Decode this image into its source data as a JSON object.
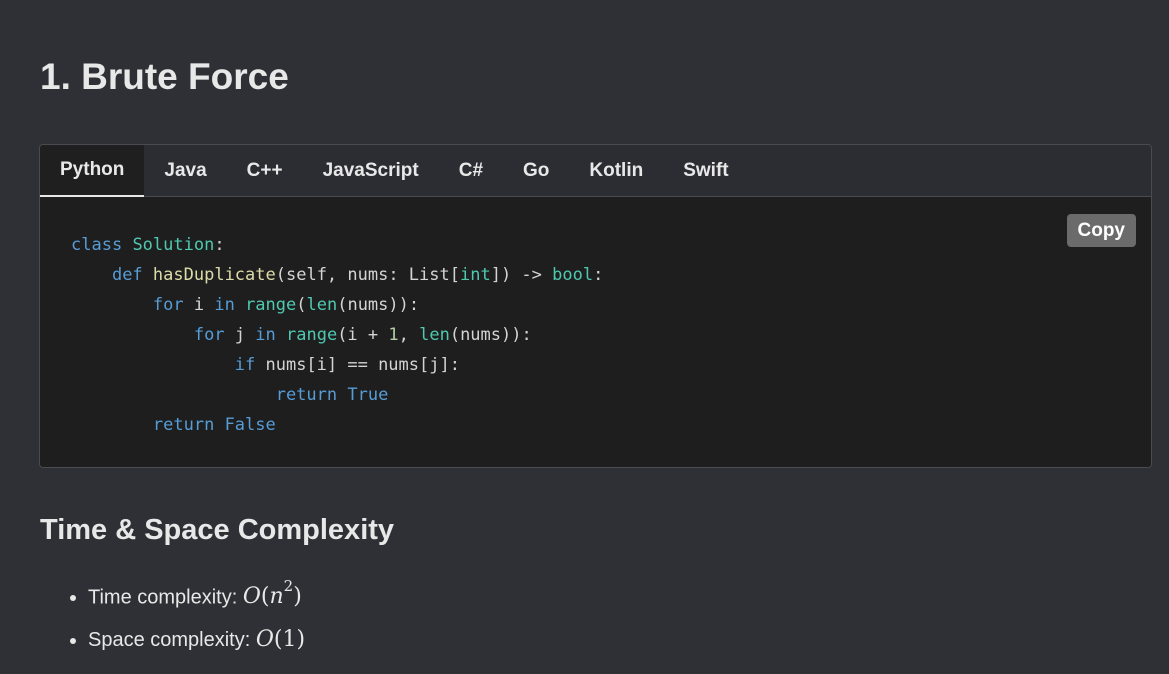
{
  "heading": "1. Brute Force",
  "tabs": [
    "Python",
    "Java",
    "C++",
    "JavaScript",
    "C#",
    "Go",
    "Kotlin",
    "Swift"
  ],
  "active_tab": "Python",
  "copy_label": "Copy",
  "code": {
    "l1": {
      "kw": "class",
      "name": "Solution",
      "colon": ":"
    },
    "l2": {
      "kw": "def",
      "fn": "hasDuplicate",
      "p1": "(self, nums: List[",
      "t1": "int",
      "p2": "]) -> ",
      "t2": "bool",
      "p3": ":"
    },
    "l3": {
      "kw1": "for",
      "var": " i ",
      "kw2": "in",
      "b1": "range",
      "p1": "(",
      "b2": "len",
      "p2": "(nums)):"
    },
    "l4": {
      "kw1": "for",
      "var": " j ",
      "kw2": "in",
      "b1": "range",
      "p1": "(i + ",
      "n": "1",
      "p2": ", ",
      "b2": "len",
      "p3": "(nums)):"
    },
    "l5": {
      "kw": "if",
      "rest": " nums[i] == nums[j]:"
    },
    "l6": {
      "kw": "return",
      "val": "True"
    },
    "l7": {
      "kw": "return",
      "val": "False"
    }
  },
  "complexity": {
    "title": "Time & Space Complexity",
    "time_label": "Time complexity: ",
    "time_value": {
      "O": "O",
      "lp": "(",
      "n": "n",
      "exp": "2",
      "rp": ")"
    },
    "space_label": "Space complexity: ",
    "space_value": {
      "O": "O",
      "lp": "(",
      "one": "1",
      "rp": ")"
    }
  }
}
